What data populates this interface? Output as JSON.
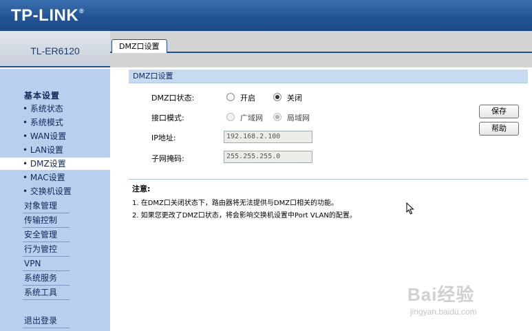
{
  "header": {
    "logo_text": "TP-LINK",
    "logo_reg": "®"
  },
  "device": {
    "model": "TL-ER6120"
  },
  "tab": {
    "label": "DMZ口设置"
  },
  "sidebar": {
    "group_title": "基本设置",
    "sub_items": [
      {
        "label": "• 系统状态"
      },
      {
        "label": "• 系统模式"
      },
      {
        "label": "• WAN设置"
      },
      {
        "label": "• LAN设置"
      },
      {
        "label": "• DMZ设置"
      },
      {
        "label": "• MAC设置"
      },
      {
        "label": "• 交换机设置"
      }
    ],
    "active_index": 4,
    "main_items": [
      {
        "label": "对象管理"
      },
      {
        "label": "传输控制"
      },
      {
        "label": "安全管理"
      },
      {
        "label": "行为管控"
      },
      {
        "label": "VPN"
      },
      {
        "label": "系统服务"
      },
      {
        "label": "系统工具"
      }
    ],
    "logout": "退出登录"
  },
  "section": {
    "title": "DMZ口设置",
    "dmz_status": {
      "label": "DMZ口状态:",
      "on": "开启",
      "off": "关闭",
      "selected": "off"
    },
    "port_mode": {
      "label": "接口模式:",
      "wan": "广域网",
      "lan": "局域网",
      "selected": "lan"
    },
    "ip": {
      "label": "IP地址:",
      "value": "192.168.2.100"
    },
    "mask": {
      "label": "子网掩码:",
      "value": "255.255.255.0"
    }
  },
  "buttons": {
    "save": "保存",
    "help": "帮助"
  },
  "notes": {
    "title": "注意:",
    "items": [
      "1. 在DMZ口关闭状态下，路由器将无法提供与DMZ口相关的功能。",
      "2. 如果您更改了DMZ口状态，将会影响交换机设置中Port VLAN的配置。"
    ]
  },
  "watermark": {
    "logo": "Bai经验",
    "url": "jingyan.baidu.com"
  },
  "colors": {
    "header": "#235596",
    "sidebar": "#b8cfee",
    "section_bar": "#c6daf2"
  }
}
